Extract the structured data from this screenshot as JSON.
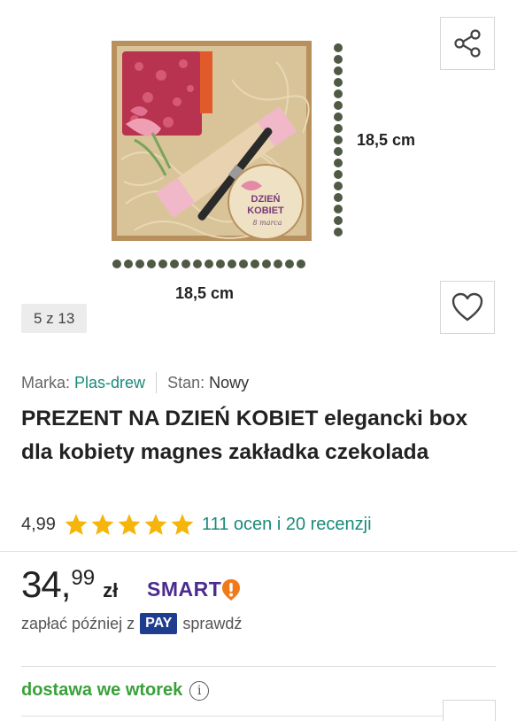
{
  "gallery": {
    "dimension_vertical": "18,5 cm",
    "dimension_horizontal": "18,5 cm",
    "counter": "5 z 13",
    "share_icon": "share-icon",
    "favorite_icon": "heart-icon"
  },
  "product": {
    "brand_label": "Marka:",
    "brand_value": "Plas-drew",
    "condition_label": "Stan:",
    "condition_value": "Nowy",
    "title": "PREZENT NA DZIEŃ KOBIET elegancki box dla kobiety magnes zakładka czekolada",
    "rating_score": "4,99",
    "rating_stars": 5,
    "reviews_text": "111 ocen i 20 recenzji",
    "star_color": "#f5b50a"
  },
  "pricing": {
    "price_int": "34",
    "price_comma": ",",
    "price_dec": "99",
    "currency": "zł",
    "smart_label": "SMART",
    "smart_color": "#4b2c8f",
    "smart_badge_color": "#f07a1a",
    "pay_later_prefix": "zapłać później z",
    "pay_badge": "PAY",
    "pay_later_link": "sprawdź"
  },
  "delivery": {
    "text": "dostawa we wtorek",
    "info_icon": "i"
  },
  "image_text": {
    "box_line1": "DZIEŃ",
    "box_line2": "KOBIET",
    "box_line3": "8 marca"
  }
}
